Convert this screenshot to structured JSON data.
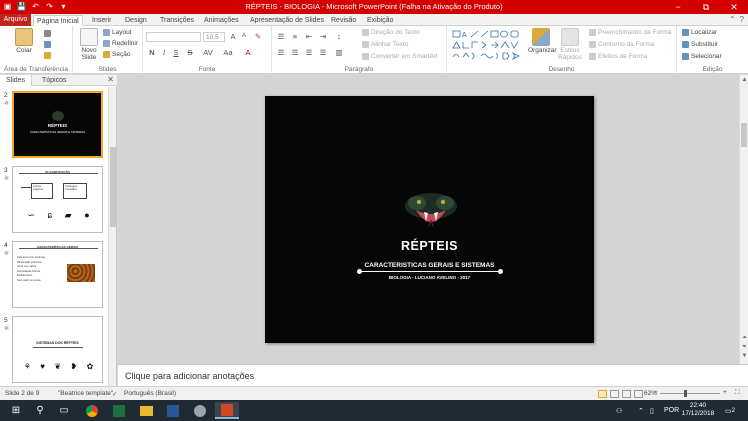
{
  "window": {
    "title": "RÉPTEIS - BIOLOGIA - Microsoft PowerPoint (Falha na Ativação do Produto)",
    "qat_icons": [
      "powerpoint-logo-icon",
      "save-icon",
      "undo-icon",
      "redo-icon",
      "customize-icon"
    ],
    "controls": [
      "−",
      "⧉",
      "✕"
    ]
  },
  "ribbon_tabs": {
    "file": "Arquivo",
    "tabs": [
      "Página Inicial",
      "Inserir",
      "Design",
      "Transições",
      "Animações",
      "Apresentação de Slides",
      "Revisão",
      "Exibição"
    ]
  },
  "ribbon": {
    "clipboard": {
      "label": "Área de Transferência",
      "paste": "Colar"
    },
    "slides": {
      "label": "Slides",
      "new_slide": "Novo Slide",
      "layout": "Layout",
      "reset": "Redefinir",
      "section": "Seção"
    },
    "font": {
      "label": "Fonte",
      "size": "10.5",
      "buttons": [
        "N",
        "I",
        "S",
        "S",
        "AV",
        "Aa",
        "A"
      ]
    },
    "paragraph": {
      "label": "Parágrafo",
      "text_direction": "Direção do Texto",
      "align_text": "Alinhar Texto",
      "convert_smartart": "Converter em SmartArt"
    },
    "drawing": {
      "label": "Desenho",
      "arrange": "Organizar",
      "quick_styles": "Estilos Rápidos",
      "shape_fill": "Preenchimento da Forma",
      "shape_outline": "Contorno da Forma",
      "shape_effects": "Efeitos de Forma"
    },
    "editing": {
      "label": "Edição",
      "find": "Localizar",
      "replace": "Substituir",
      "select": "Selecionar"
    }
  },
  "left_panel": {
    "tabs": [
      "Slides",
      "Tópicos"
    ],
    "close": "✕",
    "thumbnails": [
      {
        "num": "2",
        "title": "RÉPTEIS",
        "subtitle": "CARACTERÍSTICAS GERAIS E SISTEMAS"
      },
      {
        "num": "3",
        "title": "CLASSIFICAÇÃO",
        "boxes": [
          "Répteis",
          "Cobras, Lagartos",
          "Tartarugas, Crocodilos"
        ]
      },
      {
        "num": "4",
        "title": "CARACTERÍSTICAS GERAIS",
        "lines": [
          "Pele seca com escamas",
          "Respiração pulmonar",
          "Ovos com casca",
          "Fecundação interna",
          "Ectotérmicos",
          "Sem pelos ou penas"
        ]
      },
      {
        "num": "5",
        "title": "SISTEMAS DOS RÉPTEIS"
      }
    ]
  },
  "slide": {
    "title": "RÉPTEIS",
    "subtitle": "CARACTERISTICAS GERAIS E SISTEMAS",
    "author": "BIOLOGIA - LUCIANO AVELINO - 2017"
  },
  "notes": {
    "placeholder": "Clique para adicionar anotações"
  },
  "status": {
    "slide_info": "Slide 2 de 9",
    "theme": "\"Beatrice template\"",
    "language": "Português (Brasil)",
    "zoom": "62%",
    "zoom_fraction": 0.62
  },
  "taskbar": {
    "icons": [
      "start-icon",
      "search-icon",
      "taskview-icon",
      "chrome-icon",
      "excel-icon",
      "explorer-icon",
      "word-icon",
      "disk-icon",
      "powerpoint-icon"
    ],
    "language": "POR",
    "time": "22:40",
    "date": "17/12/2018",
    "notifications": "2"
  },
  "colors": {
    "accent": "#d40000",
    "file_tab": "#c3231f",
    "slide_bg": "#060606",
    "taskbar": "#1f2a33",
    "selection": "#f5a623"
  }
}
